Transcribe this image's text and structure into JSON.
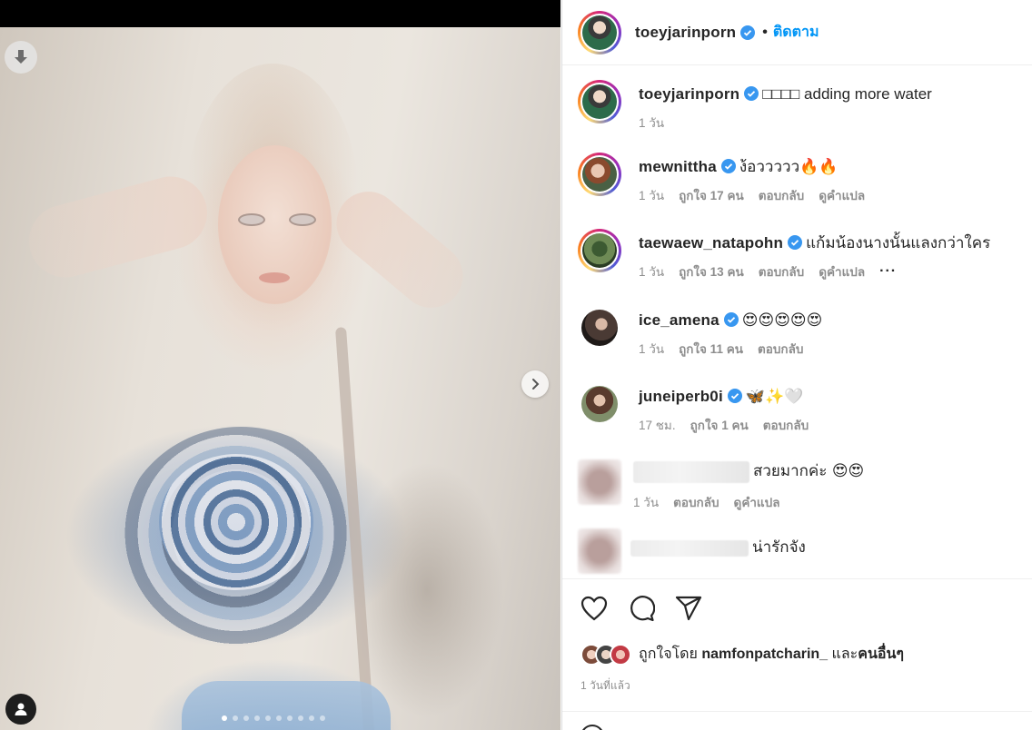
{
  "header": {
    "username": "toeyjarinporn",
    "separator": "•",
    "follow_label": "ติดตาม"
  },
  "media": {
    "carousel_total": 10,
    "carousel_active": 1
  },
  "caption": {
    "username": "toeyjarinporn",
    "text": "□□□□ adding more water",
    "time": "1 วัน"
  },
  "comments": [
    {
      "username": "mewnittha",
      "text": "ง้อววววว🔥🔥",
      "time": "1 วัน",
      "likes": "ถูกใจ 17 คน",
      "reply": "ตอบกลับ",
      "translate": "ดูคำแปล"
    },
    {
      "username": "taewaew_natapohn",
      "text": "แก้มน้องนางนั้นแลงกว่าใคร",
      "time": "1 วัน",
      "likes": "ถูกใจ 13 คน",
      "reply": "ตอบกลับ",
      "translate": "ดูคำแปล",
      "more": "···"
    },
    {
      "username": "ice_amena",
      "text": "😍😍😍😍😍",
      "time": "1 วัน",
      "likes": "ถูกใจ 11 คน",
      "reply": "ตอบกลับ"
    },
    {
      "username": "juneiperb0i",
      "text": "🦋✨🤍",
      "time": "17 ชม.",
      "likes": "ถูกใจ 1 คน",
      "reply": "ตอบกลับ"
    },
    {
      "text": "สวยมากค่ะ 😍😍",
      "time": "1 วัน",
      "reply": "ตอบกลับ",
      "translate": "ดูคำแปล"
    },
    {
      "text": "น่ารักจัง"
    }
  ],
  "likes": {
    "prefix": "ถูกใจโดย",
    "user": "namfonpatcharin_",
    "and": "และ",
    "others": "คนอื่นๆ"
  },
  "time_ago": "1 วันที่แล้ว",
  "colors": {
    "accent": "#0095f6",
    "text": "#262626",
    "muted": "#8e8e8e"
  }
}
